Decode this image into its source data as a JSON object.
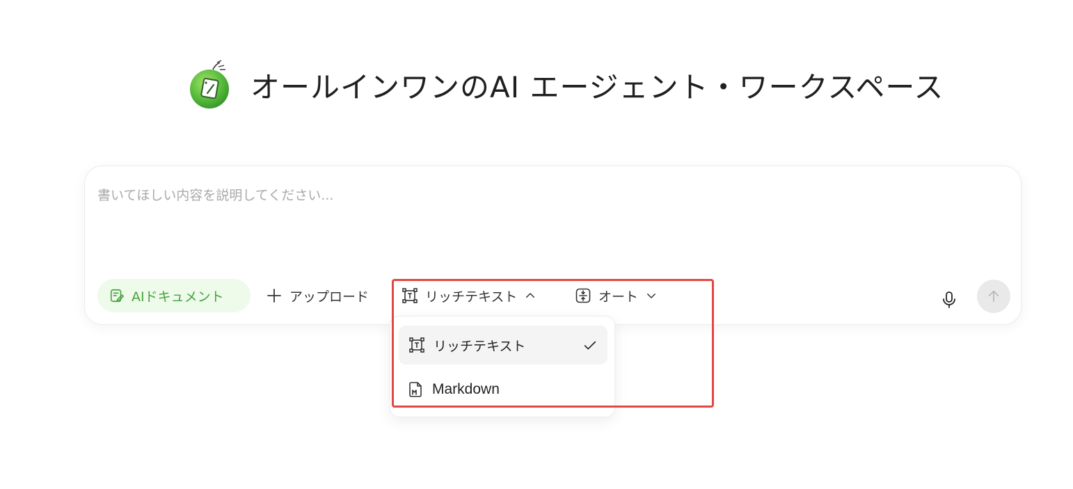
{
  "header": {
    "title": "オールインワンのAI エージェント・ワークスペース",
    "logo_icon": "apple-notepad-logo-icon"
  },
  "composer": {
    "placeholder": "書いてほしい内容を説明してください...",
    "ai_doc_button": {
      "label": "AIドキュメント",
      "icon": "edit-document-icon",
      "color": "#47a23f",
      "bg": "#eefaea"
    },
    "upload_button": {
      "label": "アップロード",
      "icon": "plus-icon"
    },
    "format_button": {
      "label": "リッチテキスト",
      "icon": "text-frame-icon",
      "state": "open"
    },
    "length_button": {
      "label": "オート",
      "icon": "vertical-compress-icon"
    },
    "mic_icon": "microphone-icon",
    "send_icon": "arrow-up-icon"
  },
  "format_dropdown": {
    "items": [
      {
        "label": "リッチテキスト",
        "icon": "text-frame-icon",
        "selected": true
      },
      {
        "label": "Markdown",
        "icon": "markdown-file-icon",
        "selected": false
      }
    ]
  },
  "highlight": {
    "color": "#e4473f"
  }
}
